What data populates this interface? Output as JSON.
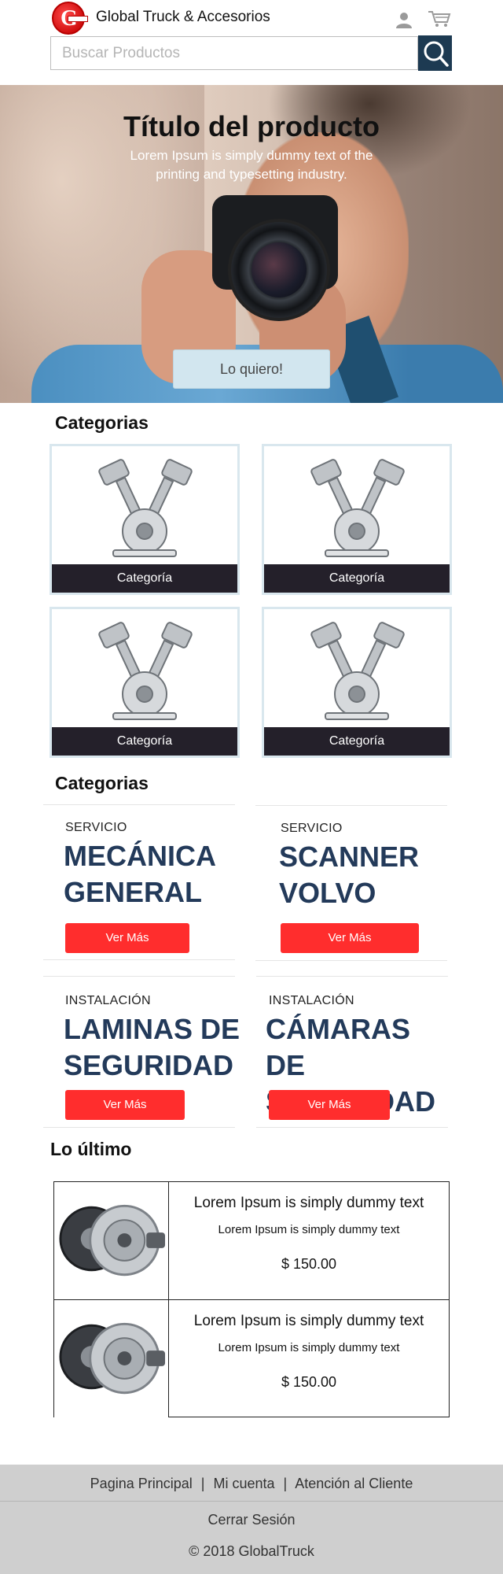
{
  "header": {
    "brand": "Global Truck & Accesorios",
    "search_placeholder": "Buscar Productos"
  },
  "hero": {
    "title": "Título del producto",
    "subtitle": "Lorem Ipsum is simply dummy text of the printing and typesetting industry.",
    "cta_label": "Lo quiero!"
  },
  "categories_section": {
    "title": "Categorias",
    "tiles": [
      {
        "label": "Categoría"
      },
      {
        "label": "Categoría"
      },
      {
        "label": "Categoría"
      },
      {
        "label": "Categoría"
      }
    ]
  },
  "services_section": {
    "title": "Categorias",
    "cards": [
      {
        "kicker": "SERVICIO",
        "title_line1": "MECÁNICA",
        "title_line2": "GENERAL",
        "button": "Ver Más"
      },
      {
        "kicker": "SERVICIO",
        "title_line1": "SCANNER",
        "title_line2": "VOLVO",
        "button": "Ver Más"
      },
      {
        "kicker": "INSTALACIÓN",
        "title_line1": "LAMINAS DE",
        "title_line2": "SEGURIDAD",
        "button": "Ver Más"
      },
      {
        "kicker": "INSTALACIÓN",
        "title_line1": "CÁMARAS DE",
        "title_line2": "SEGURIDAD",
        "button": "Ver Más"
      }
    ]
  },
  "latest_section": {
    "title": "Lo último",
    "products": [
      {
        "title": "Lorem Ipsum is simply dummy text",
        "description": "Lorem Ipsum is simply dummy text",
        "price": "$ 150.00"
      },
      {
        "title": "Lorem Ipsum is simply dummy text",
        "description": "Lorem Ipsum is simply dummy text",
        "price": "$ 150.00"
      }
    ]
  },
  "footer": {
    "links": [
      "Pagina Principal",
      "Mi cuenta",
      "Atención al Cliente"
    ],
    "separator": "|",
    "logout": "Cerrar Sesión",
    "copyright": "© 2018 GlobalTruck"
  },
  "colors": {
    "search_button": "#1d3a52",
    "service_title": "#233a5a",
    "cta_red": "#ff2d2d",
    "category_label_bg": "#24202a",
    "footer_bg": "#cfcfcf"
  },
  "icons": [
    "logo-g-icon",
    "user-icon",
    "cart-icon",
    "search-icon",
    "engine-part-icon",
    "clutch-kit-icon"
  ]
}
